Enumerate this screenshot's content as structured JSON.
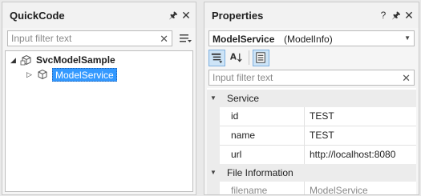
{
  "quickcode": {
    "title": "QuickCode",
    "filter_placeholder": "Input filter text",
    "tree": {
      "root": {
        "label": "SvcModelSample",
        "expanded": true
      },
      "child": {
        "label": "ModelService",
        "selected": true,
        "expanded": false
      }
    }
  },
  "properties": {
    "title": "Properties",
    "object_name": "ModelService",
    "object_type": "(ModelInfo)",
    "filter_placeholder": "Input filter text",
    "toolbar": [
      "categorized-sort",
      "alphabetical-sort",
      "property-pages"
    ],
    "categories": [
      {
        "label": "Service",
        "rows": [
          {
            "name": "id",
            "value": "TEST"
          },
          {
            "name": "name",
            "value": "TEST"
          },
          {
            "name": "url",
            "value": "http://localhost:8080"
          }
        ]
      },
      {
        "label": "File Information",
        "rows": [
          {
            "name": "filename",
            "value": "ModelService",
            "readonly": true
          }
        ]
      }
    ]
  },
  "colors": {
    "selection": "#3399ff",
    "panel_bg": "#f5f5f5",
    "toolbar_active": "#cde4f7"
  }
}
